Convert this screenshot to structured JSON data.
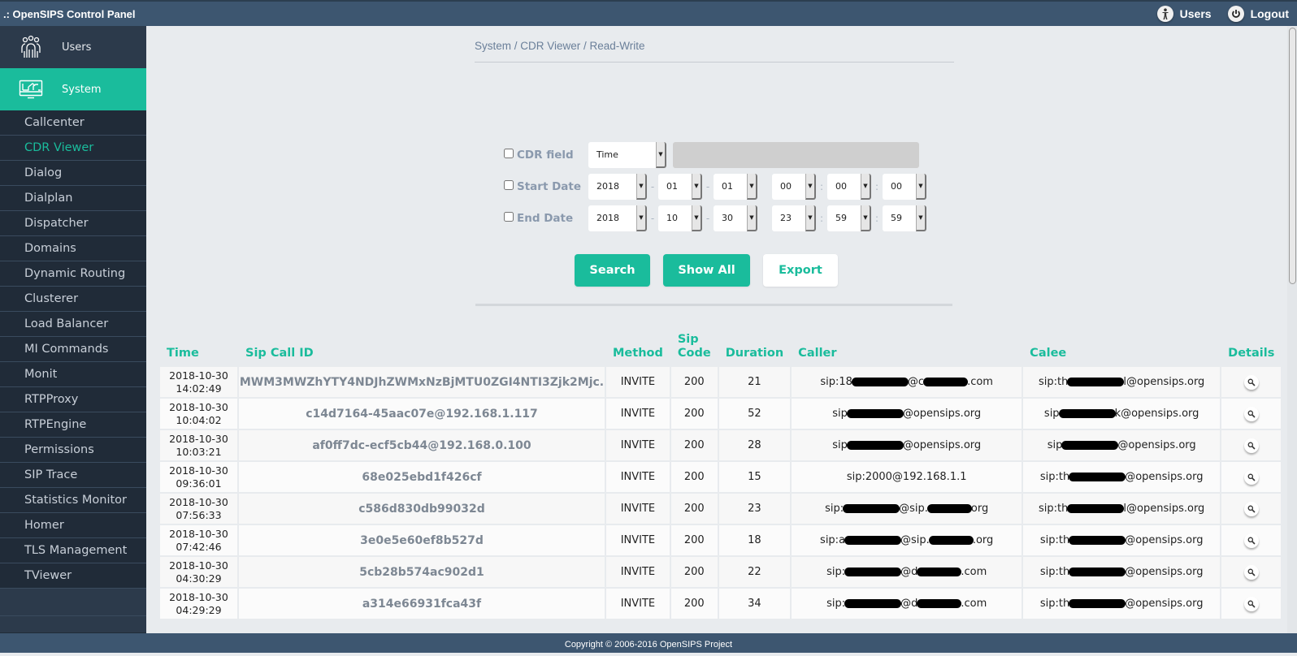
{
  "app": {
    "title": ".: OpenSIPS Control Panel",
    "top_links": [
      {
        "label": "Users",
        "icon": "person-icon"
      },
      {
        "label": "Logout",
        "icon": "power-icon"
      }
    ]
  },
  "sidebar": {
    "sections": [
      {
        "label": "Users",
        "icon": "users-group-icon",
        "active": false
      },
      {
        "label": "System",
        "icon": "system-monitor-icon",
        "active": true
      }
    ],
    "items": [
      {
        "label": "Callcenter"
      },
      {
        "label": "CDR Viewer",
        "active": true
      },
      {
        "label": "Dialog"
      },
      {
        "label": "Dialplan"
      },
      {
        "label": "Dispatcher"
      },
      {
        "label": "Domains"
      },
      {
        "label": "Dynamic Routing"
      },
      {
        "label": "Clusterer"
      },
      {
        "label": "Load Balancer"
      },
      {
        "label": "MI Commands"
      },
      {
        "label": "Monit"
      },
      {
        "label": "RTPProxy"
      },
      {
        "label": "RTPEngine"
      },
      {
        "label": "Permissions"
      },
      {
        "label": "SIP Trace"
      },
      {
        "label": "Statistics Monitor"
      },
      {
        "label": "Homer"
      },
      {
        "label": "TLS Management"
      },
      {
        "label": "TViewer"
      }
    ]
  },
  "breadcrumb": "System / CDR Viewer / Read-Write",
  "filters": {
    "cdr_field": {
      "label": "CDR field",
      "checked": false,
      "selected": "Time",
      "value": ""
    },
    "start_date": {
      "label": "Start Date",
      "checked": false,
      "year": "2018",
      "month": "01",
      "day": "01",
      "hour": "00",
      "minute": "00",
      "second": "00"
    },
    "end_date": {
      "label": "End Date",
      "checked": false,
      "year": "2018",
      "month": "10",
      "day": "30",
      "hour": "23",
      "minute": "59",
      "second": "59"
    },
    "date_sep": "-",
    "time_sep": ":"
  },
  "buttons": {
    "search": "Search",
    "show_all": "Show All",
    "export": "Export"
  },
  "table": {
    "headers": {
      "time": "Time",
      "call_id": "Sip Call ID",
      "method": "Method",
      "sip_code": "Sip Code",
      "duration": "Duration",
      "caller": "Caller",
      "callee": "Calee",
      "details": "Details"
    },
    "rows": [
      {
        "date": "2018-10-30",
        "time": "14:02:49",
        "call_id": "MWM3MWZhYTY4NDJhZWMxNzBjMTU0ZGI4NTI3Zjk2Mjc.",
        "method": "INVITE",
        "sip_code": "200",
        "duration": "21",
        "caller": [
          "sip:18",
          "@c",
          ".com"
        ],
        "callee": [
          "sip:th",
          "l@opensips.org"
        ]
      },
      {
        "date": "2018-10-30",
        "time": "10:04:02",
        "call_id": "c14d7164-45aac07e@192.168.1.117",
        "method": "INVITE",
        "sip_code": "200",
        "duration": "52",
        "caller": [
          "sip",
          "@opensips.org"
        ],
        "callee": [
          "sip",
          "k@opensips.org"
        ]
      },
      {
        "date": "2018-10-30",
        "time": "10:03:21",
        "call_id": "af0ff7dc-ecf5cb44@192.168.0.100",
        "method": "INVITE",
        "sip_code": "200",
        "duration": "28",
        "caller": [
          "sip",
          "@opensips.org"
        ],
        "callee": [
          "sip",
          "@opensips.org"
        ]
      },
      {
        "date": "2018-10-30",
        "time": "09:36:01",
        "call_id": "68e025ebd1f426cf",
        "method": "INVITE",
        "sip_code": "200",
        "duration": "15",
        "caller": [
          "sip:2000@192.168.1.1"
        ],
        "callee": [
          "sip:th",
          "@opensips.org"
        ]
      },
      {
        "date": "2018-10-30",
        "time": "07:56:33",
        "call_id": "c586d830db99032d",
        "method": "INVITE",
        "sip_code": "200",
        "duration": "23",
        "caller": [
          "sip:",
          "@sip.",
          "org"
        ],
        "callee": [
          "sip:th",
          "l@opensips.org"
        ]
      },
      {
        "date": "2018-10-30",
        "time": "07:42:46",
        "call_id": "3e0e5e60ef8b527d",
        "method": "INVITE",
        "sip_code": "200",
        "duration": "18",
        "caller": [
          "sip:a",
          "@sip.",
          ".org"
        ],
        "callee": [
          "sip:th",
          "@opensips.org"
        ]
      },
      {
        "date": "2018-10-30",
        "time": "04:30:29",
        "call_id": "5cb28b574ac902d1",
        "method": "INVITE",
        "sip_code": "200",
        "duration": "22",
        "caller": [
          "sip:",
          "@d",
          ".com"
        ],
        "callee": [
          "sip:th",
          "@opensips.org"
        ]
      },
      {
        "date": "2018-10-30",
        "time": "04:29:29",
        "call_id": "a314e66931fca43f",
        "method": "INVITE",
        "sip_code": "200",
        "duration": "34",
        "caller": [
          "sip:",
          "@d",
          ".com"
        ],
        "callee": [
          "sip:th",
          "@opensips.org"
        ]
      }
    ]
  },
  "footer": "Copyright © 2006-2016 OpenSIPS Project"
}
